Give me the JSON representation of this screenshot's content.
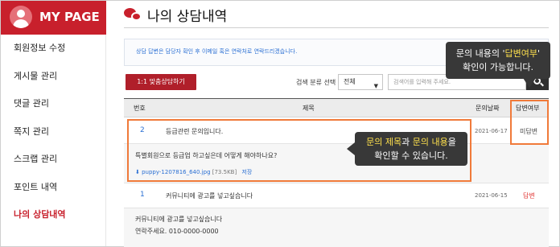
{
  "sidebar": {
    "title": "MY PAGE",
    "items": [
      {
        "label": "회원정보 수정"
      },
      {
        "label": "게시물 관리"
      },
      {
        "label": "댓글 관리"
      },
      {
        "label": "쪽지 관리"
      },
      {
        "label": "스크랩 관리"
      },
      {
        "label": "포인트 내역"
      },
      {
        "label": "나의 상담내역"
      }
    ]
  },
  "main": {
    "title": "나의 상담내역",
    "notice": "상담 답변은 담당자 확인 후 이메일 혹은 연락처로 연락드리겠습니다.",
    "consult_button": "1:1 맞춤상담하기",
    "search": {
      "label": "검색 분류 선택",
      "select_value": "전체",
      "placeholder": "검색어를 입력해 주세요."
    },
    "table": {
      "headers": {
        "num": "번호",
        "title": "제목",
        "date": "문의날짜",
        "status": "답변여부"
      },
      "rows": [
        {
          "num": "2",
          "title": "등급관련 문의입니다.",
          "date": "2021-06-17",
          "status": "미답변",
          "content": "특별회원으로 등급업 하고싶은데 어떻게 해야하나요?",
          "file_name": "puppy-1207816_640.jpg",
          "file_size": "[73.5KB]",
          "file_save": "저장"
        },
        {
          "num": "1",
          "title": "커뮤니티에 광고를 넣고싶습니다",
          "date": "2021-06-15",
          "status": "답변",
          "content_line1": "커뮤니티에 광고를 넣고싶습니다",
          "content_line2": "연락주세요. 010-0000-0000"
        }
      ]
    }
  },
  "annotations": {
    "status_callout": {
      "line1_pre": "문의 내용의 '",
      "line1_hl": "답변여부",
      "line1_post": "'",
      "line2": "확인이 가능합니다."
    },
    "content_callout": {
      "hl1": "문의 제목",
      "mid": "과 ",
      "hl2": "문의 내용",
      "post": "을",
      "line2": "확인할 수 있습니다."
    }
  },
  "colors": {
    "brand": "#c8202c",
    "highlight": "#f07a3a",
    "callout_bg": "#383838",
    "callout_accent": "#ffe14d",
    "link": "#2a6fd3",
    "answered": "#e0312f"
  }
}
